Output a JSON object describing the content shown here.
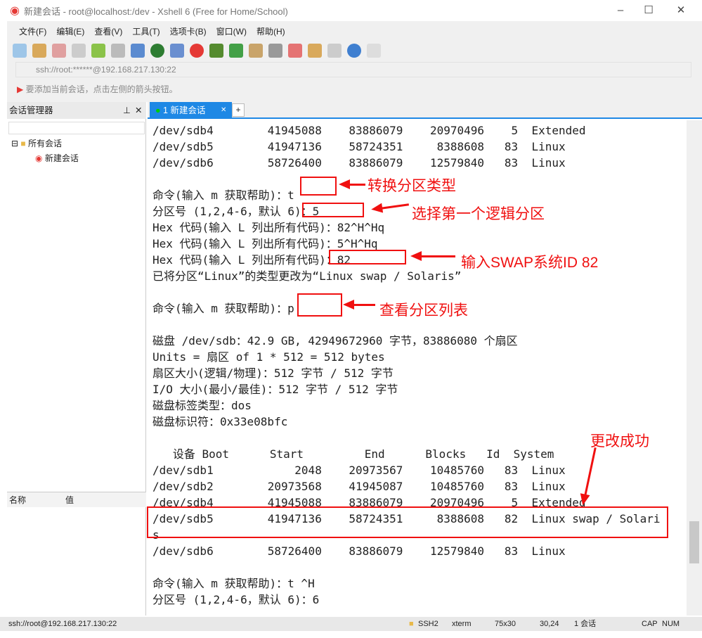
{
  "window": {
    "title": "新建会话 - root@localhost:/dev - Xshell 6 (Free for Home/School)"
  },
  "menu": [
    "文件(F)",
    "编辑(E)",
    "查看(V)",
    "工具(T)",
    "选项卡(B)",
    "窗口(W)",
    "帮助(H)"
  ],
  "address": "ssh://root:******@192.168.217.130:22",
  "hint": "要添加当前会话，点击左侧的箭头按钮。",
  "sidebar": {
    "title": "会话管理器",
    "tree": [
      "所有会话",
      "新建会话"
    ],
    "prop_headers": [
      "名称",
      "值"
    ]
  },
  "tab": {
    "label": "1 新建会话",
    "add": "+"
  },
  "terminal": {
    "lines": [
      "/dev/sdb4        41945088    83886079    20970496    5  Extended",
      "/dev/sdb5        41947136    58724351     8388608   83  Linux",
      "/dev/sdb6        58726400    83886079    12579840   83  Linux",
      "",
      "命令(输入 m 获取帮助)：t",
      "分区号 (1,2,4-6，默认 6)：5",
      "Hex 代码(输入 L 列出所有代码)：82^H^Hq",
      "Hex 代码(输入 L 列出所有代码)：5^H^Hq",
      "Hex 代码(输入 L 列出所有代码)：82",
      "已将分区“Linux”的类型更改为“Linux swap / Solaris”",
      "",
      "命令(输入 m 获取帮助)：p",
      "",
      "磁盘 /dev/sdb：42.9 GB, 42949672960 字节，83886080 个扇区",
      "Units = 扇区 of 1 * 512 = 512 bytes",
      "扇区大小(逻辑/物理)：512 字节 / 512 字节",
      "I/O 大小(最小/最佳)：512 字节 / 512 字节",
      "磁盘标签类型：dos",
      "磁盘标识符：0x33e08bfc",
      "",
      "   设备 Boot      Start         End      Blocks   Id  System",
      "/dev/sdb1            2048    20973567    10485760   83  Linux",
      "/dev/sdb2        20973568    41945087    10485760   83  Linux",
      "/dev/sdb4        41945088    83886079    20970496    5  Extended",
      "/dev/sdb5        41947136    58724351     8388608   82  Linux swap / Solari",
      "s",
      "/dev/sdb6        58726400    83886079    12579840   83  Linux",
      "",
      "命令(输入 m 获取帮助)：t ^H",
      "分区号 (1,2,4-6，默认 6)：6"
    ]
  },
  "annotations": [
    "转换分区类型",
    "选择第一个逻辑分区",
    "输入SWAP系统ID 82",
    "查看分区列表",
    "更改成功"
  ],
  "status": {
    "connection": "ssh://root@192.168.217.130:22",
    "protocol": "SSH2",
    "term": "xterm",
    "size": "75x30",
    "cursor": "30,24",
    "sessions": "1 会话",
    "caps": "CAP",
    "num": "NUM"
  },
  "colors": {
    "accent": "#1e88e5",
    "annotation": "#f01010"
  }
}
